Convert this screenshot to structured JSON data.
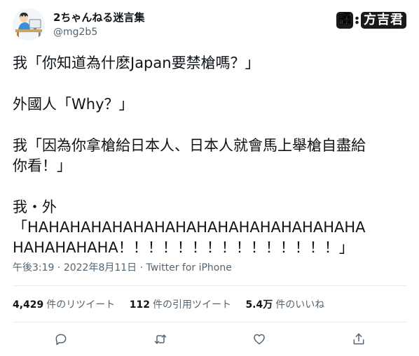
{
  "author": {
    "display_name": "2ちゃんねる迷言集",
    "handle": "@mg2b5"
  },
  "watermark": {
    "label": "譯",
    "name": "方吉君"
  },
  "tweet": {
    "lines": [
      "我「你知道為什麽Japan要禁槍嗎？」",
      "外國人「Why？」",
      "我「因為你拿槍給日本人、日本人就會馬上舉槍自盡給",
      "你看！」",
      "我・外",
      "「HAHAHAHAHAHAHAHAHAHAHAHAHAHAHAHA",
      "HAHAHAHAHA！！！！！！！！！！！！！！！」"
    ],
    "time": "午後3:19",
    "date": "2022年8月11日",
    "separator": " · ",
    "source": "Twitter for iPhone"
  },
  "stats": {
    "retweets_count": "4,429",
    "retweets_label": "件のリツイート",
    "quotes_count": "112",
    "quotes_label": "件の引用ツイート",
    "likes_count": "5.4万",
    "likes_label": "件のいいね"
  },
  "actions": {
    "reply_icon": "reply-icon",
    "retweet_icon": "retweet-icon",
    "like_icon": "heart-icon",
    "share_icon": "share-icon"
  }
}
